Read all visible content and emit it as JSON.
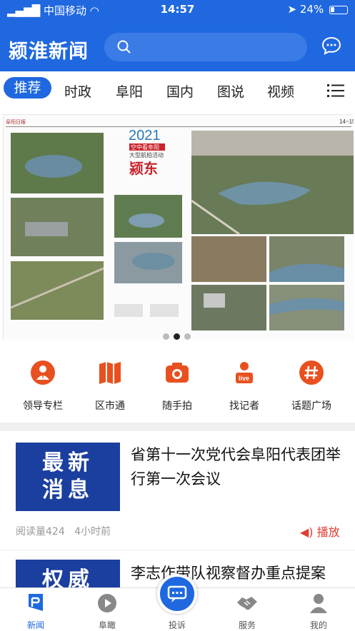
{
  "status": {
    "carrier": "中国移动",
    "time": "14:57",
    "battery": "24%",
    "battery_level": 0.24
  },
  "header": {
    "logo": "颍淮新闻",
    "search_placeholder": ""
  },
  "tabs": [
    "推荐",
    "时政",
    "阜阳",
    "国内",
    "图说",
    "视频"
  ],
  "banner": {
    "year": "2021",
    "subtitle": "空中看阜阳",
    "subtitle2": "大型航拍活动",
    "headline": "颍东",
    "page_num": "14~15",
    "dots": 3,
    "active_dot": 1
  },
  "quick_links": [
    "领导专栏",
    "区市通",
    "随手拍",
    "找记者",
    "话题广场"
  ],
  "news": [
    {
      "thumb_line1": "最新",
      "thumb_line2": "消息",
      "title": "省第十一次党代会阜阳代表团举行第一次会议",
      "reads": "阅读量424",
      "time": "4小时前",
      "play": "播放"
    },
    {
      "thumb_line1": "权威",
      "thumb_line2": "",
      "title": "李志作带队视察督办重点提案"
    }
  ],
  "tabbar": [
    "新闻",
    "阜瞰",
    "投诉",
    "服务",
    "我的"
  ],
  "colors": {
    "brand": "#1f68e0",
    "accent": "#e8511f",
    "play": "#e13c2f"
  }
}
